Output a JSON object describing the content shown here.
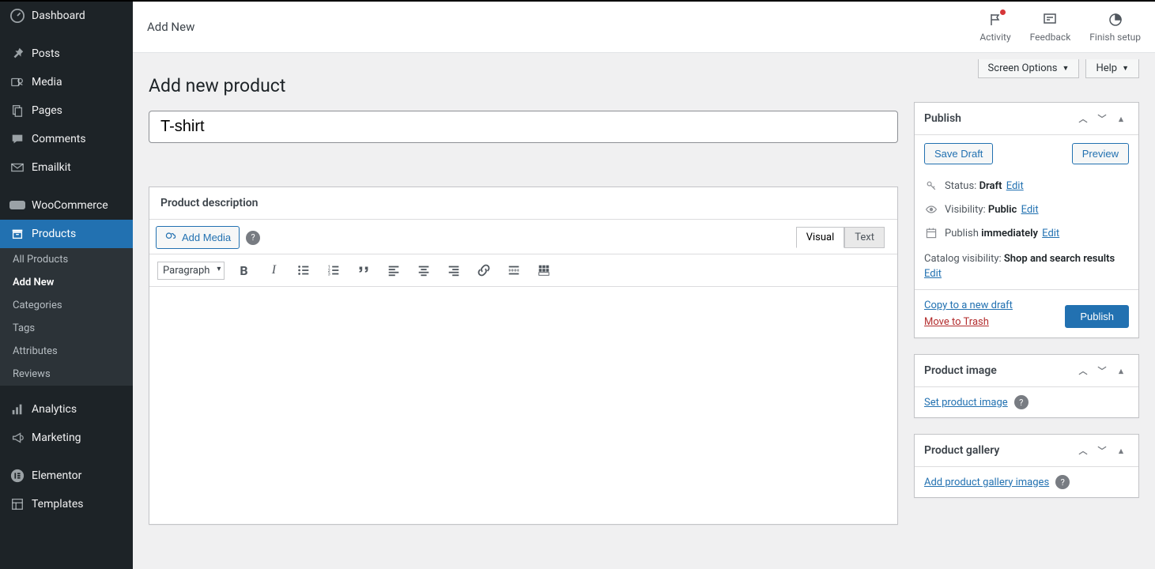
{
  "sidebar": {
    "items": [
      {
        "label": "Dashboard",
        "icon": "dashboard"
      },
      {
        "label": "Posts",
        "icon": "pin"
      },
      {
        "label": "Media",
        "icon": "media"
      },
      {
        "label": "Pages",
        "icon": "pages"
      },
      {
        "label": "Comments",
        "icon": "comment"
      },
      {
        "label": "Emailkit",
        "icon": "mail"
      },
      {
        "label": "WooCommerce",
        "icon": "woo"
      },
      {
        "label": "Products",
        "icon": "archive",
        "active": true
      },
      {
        "label": "Analytics",
        "icon": "chart"
      },
      {
        "label": "Marketing",
        "icon": "megaphone"
      },
      {
        "label": "Elementor",
        "icon": "elementor"
      },
      {
        "label": "Templates",
        "icon": "templates"
      }
    ],
    "products_submenu": [
      {
        "label": "All Products"
      },
      {
        "label": "Add New",
        "current": true
      },
      {
        "label": "Categories"
      },
      {
        "label": "Tags"
      },
      {
        "label": "Attributes"
      },
      {
        "label": "Reviews"
      }
    ]
  },
  "topbar": {
    "title": "Add New",
    "actions": {
      "activity": "Activity",
      "feedback": "Feedback",
      "finish": "Finish setup"
    }
  },
  "screen_options": {
    "screen_options": "Screen Options",
    "help": "Help"
  },
  "page": {
    "heading": "Add new product",
    "product_title": "T-shirt"
  },
  "editor": {
    "panel_title": "Product description",
    "add_media": "Add Media",
    "tab_visual": "Visual",
    "tab_text": "Text",
    "format": "Paragraph"
  },
  "publish": {
    "title": "Publish",
    "save_draft": "Save Draft",
    "preview": "Preview",
    "status_label": "Status:",
    "status_value": "Draft",
    "visibility_label": "Visibility:",
    "visibility_value": "Public",
    "publish_label_1": "Publish",
    "publish_label_2": "immediately",
    "catalog_label": "Catalog visibility:",
    "catalog_value": "Shop and search results",
    "edit": "Edit",
    "copy_draft": "Copy to a new draft",
    "trash": "Move to Trash",
    "publish_btn": "Publish"
  },
  "product_image": {
    "title": "Product image",
    "link": "Set product image"
  },
  "gallery": {
    "title": "Product gallery",
    "link": "Add product gallery images"
  }
}
